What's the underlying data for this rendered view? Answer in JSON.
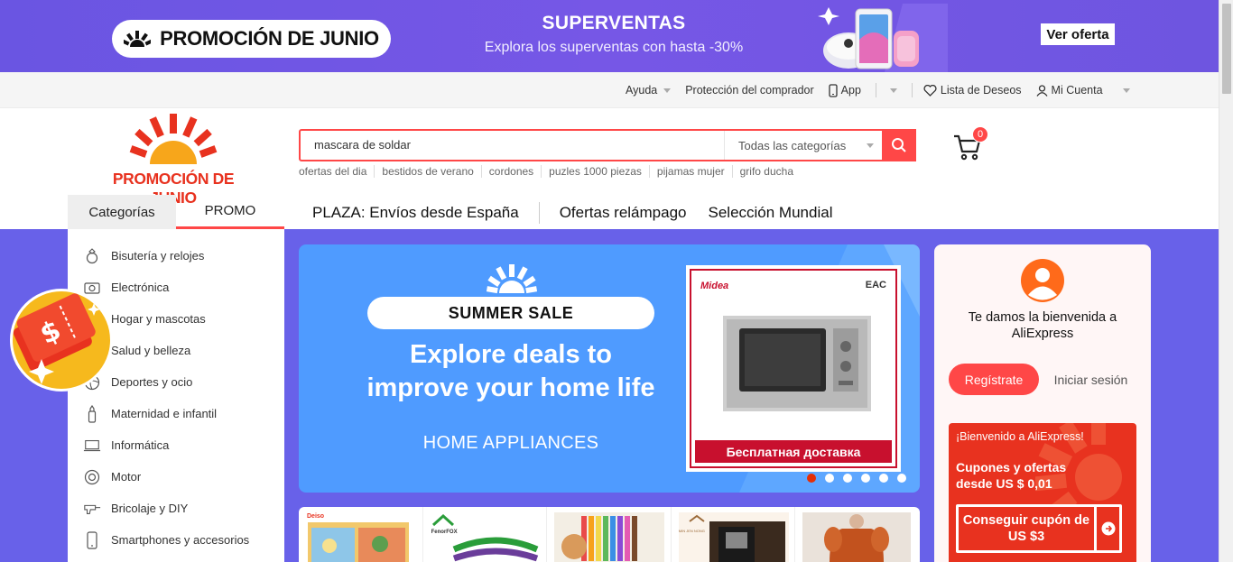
{
  "top_banner": {
    "promo_label": "PROMOCIÓN DE JUNIO",
    "title": "SUPERVENTAS",
    "subtitle": "Explora los superventas con hasta -30%",
    "cta": "Ver oferta",
    "bg_color": "#6a55e2"
  },
  "util_bar": {
    "help": "Ayuda",
    "buyer_protection": "Protección del comprador",
    "app": "App",
    "wishlist": "Lista de Deseos",
    "account": "Mi Cuenta"
  },
  "logo": {
    "text": "PROMOCIÓN DE JUNIO"
  },
  "search": {
    "query": "mascara de soldar",
    "category": "Todas las categorías",
    "hot_words": [
      "ofertas del dia",
      "bestidos de verano",
      "cordones",
      "puzles 1000 piezas",
      "pijamas mujer",
      "grifo ducha"
    ]
  },
  "cart": {
    "count": "0"
  },
  "tabs": {
    "categories": "Categorías",
    "promo": "PROMO"
  },
  "main_nav": [
    "PLAZA: Envíos desde España",
    "Ofertas relámpago",
    "Selección Mundial"
  ],
  "categories": [
    {
      "label": "Bisutería y relojes",
      "icon": "ring-icon"
    },
    {
      "label": "Electrónica",
      "icon": "camera-icon"
    },
    {
      "label": "Hogar y mascotas",
      "icon": "home-icon"
    },
    {
      "label": "Salud y belleza",
      "icon": "lipstick-icon"
    },
    {
      "label": "Deportes y ocio",
      "icon": "ball-icon"
    },
    {
      "label": "Maternidad e infantil",
      "icon": "baby-bottle-icon"
    },
    {
      "label": "Informática",
      "icon": "laptop-icon"
    },
    {
      "label": "Motor",
      "icon": "tire-icon"
    },
    {
      "label": "Bricolaje y DIY",
      "icon": "drill-icon"
    },
    {
      "label": "Smartphones y accesorios",
      "icon": "phone-icon"
    }
  ],
  "hero": {
    "pill": "SUMMER SALE",
    "headline_1": "Explore deals to",
    "headline_2": "improve your home life",
    "sub": "HOME APPLIANCES",
    "product_brand": "Midea",
    "product_mark": "EAC",
    "product_footer": "Бесплатная доставка",
    "slides": 6,
    "active_slide": 1
  },
  "thumbs": [
    {
      "brand": "Deiso"
    },
    {
      "brand": "FenorFOX"
    },
    {
      "brand": ""
    },
    {
      "brand": "MIN JEN NONG"
    },
    {
      "brand": ""
    }
  ],
  "welcome": {
    "greeting": "Te damos la bienvenida a AliExpress",
    "register": "Regístrate",
    "login": "Iniciar sesión",
    "coupon_welcome": "¡Bienvenido a AliExpress!",
    "coupon_title": "Cupones y ofertas desde US $ 0,01",
    "coupon_cta": "Conseguir cupón de US $3"
  },
  "colors": {
    "accent": "#ff4747",
    "purple_bg": "#6861e9",
    "hero_blue": "#4f9bff",
    "logo_red": "#e8321f"
  }
}
